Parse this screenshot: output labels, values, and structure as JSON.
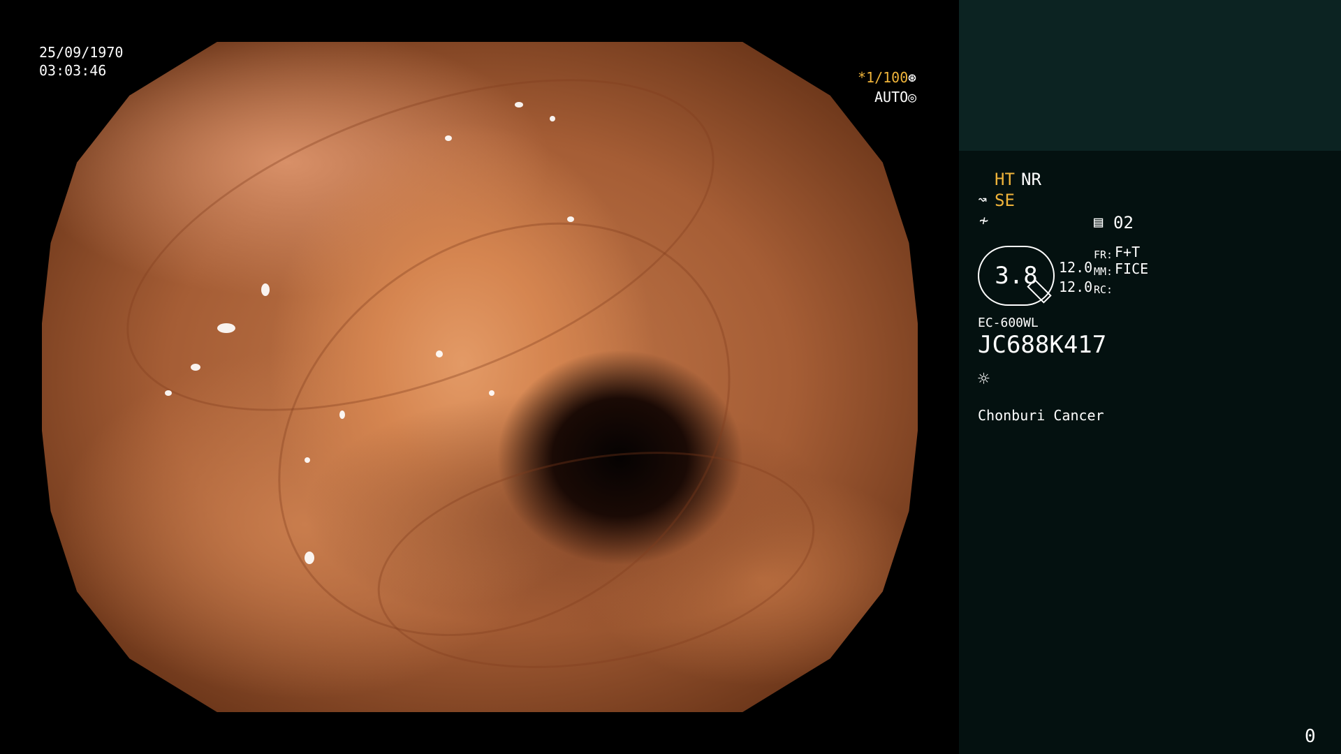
{
  "video": {
    "date": "25/09/1970",
    "time": "03:03:46",
    "shutter": "*1/100",
    "shutter_icon": "shutter-icon",
    "exposure_mode": "AUTO",
    "exposure_icon": "iris-icon"
  },
  "panel": {
    "enhance_a": "HT",
    "enhance_b": "NR",
    "se_symbol": "↝",
    "se_label": "SE",
    "scissors_symbol": "≁",
    "memory_icon": "memory-card-icon",
    "memory_value": "02",
    "zoom_value": "3.8",
    "value_1": "12.0",
    "value_2": "12.0",
    "fr_label": "FR:",
    "fr_value": "F+T",
    "mm_label": "MM:",
    "mm_value": "FICE",
    "rc_label": "RC:",
    "scope_model": "EC-600WL",
    "serial": "JC688K417",
    "light_icon": "light-sun-icon",
    "institution": "Chonburi Cancer",
    "counter": "0"
  },
  "colors": {
    "accent_yellow": "#f0b43a",
    "panel_bg": "#041110",
    "panel_top_bg": "#0c2322"
  }
}
